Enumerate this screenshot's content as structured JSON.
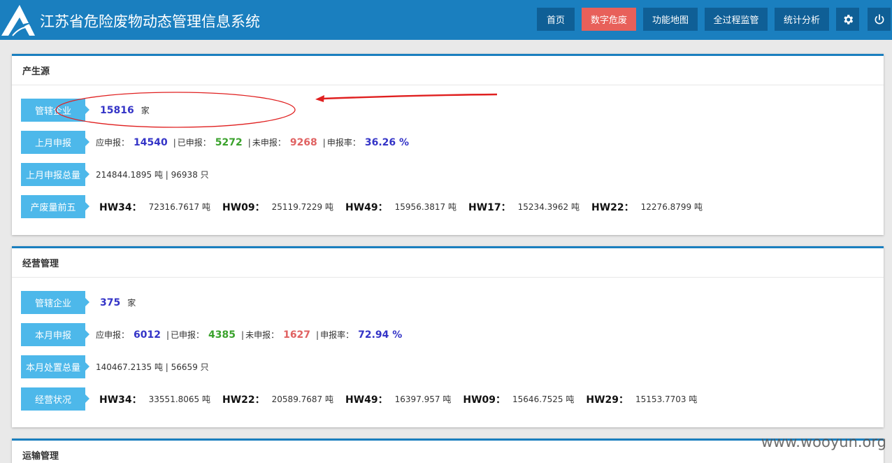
{
  "header": {
    "title": "江苏省危险废物动态管理信息系统",
    "colors": {
      "bar": "#1a7fbf",
      "button": "#0f5f96",
      "active": "#e8605a"
    },
    "nav": [
      {
        "label": "首页",
        "active": false
      },
      {
        "label": "数字危废",
        "active": true
      },
      {
        "label": "功能地图",
        "active": false
      },
      {
        "label": "全过程监管",
        "active": false
      },
      {
        "label": "统计分析",
        "active": false
      }
    ],
    "icons": [
      "gear-icon",
      "power-icon"
    ]
  },
  "sections": {
    "producer": {
      "title": "产生源",
      "managed": {
        "label": "管辖企业",
        "value": "15816",
        "unit": "家"
      },
      "report": {
        "label": "上月申报",
        "should_label": "应申报：",
        "should_value": "14540",
        "done_label": "已申报：",
        "done_value": "5272",
        "pending_label": "未申报：",
        "pending_value": "9268",
        "rate_label": "申报率：",
        "rate_value": "36.26 %"
      },
      "total": {
        "label": "上月申报总量",
        "value": "214844.1895 吨 | 96938 只"
      },
      "top5": {
        "label": "产废量前五",
        "items": [
          {
            "code": "HW34：",
            "value": "72316.7617 吨"
          },
          {
            "code": "HW09：",
            "value": "25119.7229 吨"
          },
          {
            "code": "HW49：",
            "value": "15956.3817 吨"
          },
          {
            "code": "HW17：",
            "value": "15234.3962 吨"
          },
          {
            "code": "HW22：",
            "value": "12276.8799 吨"
          }
        ]
      }
    },
    "operation": {
      "title": "经营管理",
      "managed": {
        "label": "管辖企业",
        "value": "375",
        "unit": "家"
      },
      "report": {
        "label": "本月申报",
        "should_label": "应申报：",
        "should_value": "6012",
        "done_label": "已申报：",
        "done_value": "4385",
        "pending_label": "未申报：",
        "pending_value": "1627",
        "rate_label": "申报率：",
        "rate_value": "72.94 %"
      },
      "total": {
        "label": "本月处置总量",
        "value": "140467.2135 吨 | 56659 只"
      },
      "status": {
        "label": "经营状况",
        "items": [
          {
            "code": "HW34：",
            "value": "33551.8065 吨"
          },
          {
            "code": "HW22：",
            "value": "20589.7687 吨"
          },
          {
            "code": "HW49：",
            "value": "16397.957 吨"
          },
          {
            "code": "HW09：",
            "value": "15646.7525 吨"
          },
          {
            "code": "HW29：",
            "value": "15153.7703 吨"
          }
        ]
      }
    },
    "transport": {
      "title": "运输管理"
    }
  },
  "annotation": {
    "color": "#e02020"
  },
  "watermark": "www.wooyun.org"
}
